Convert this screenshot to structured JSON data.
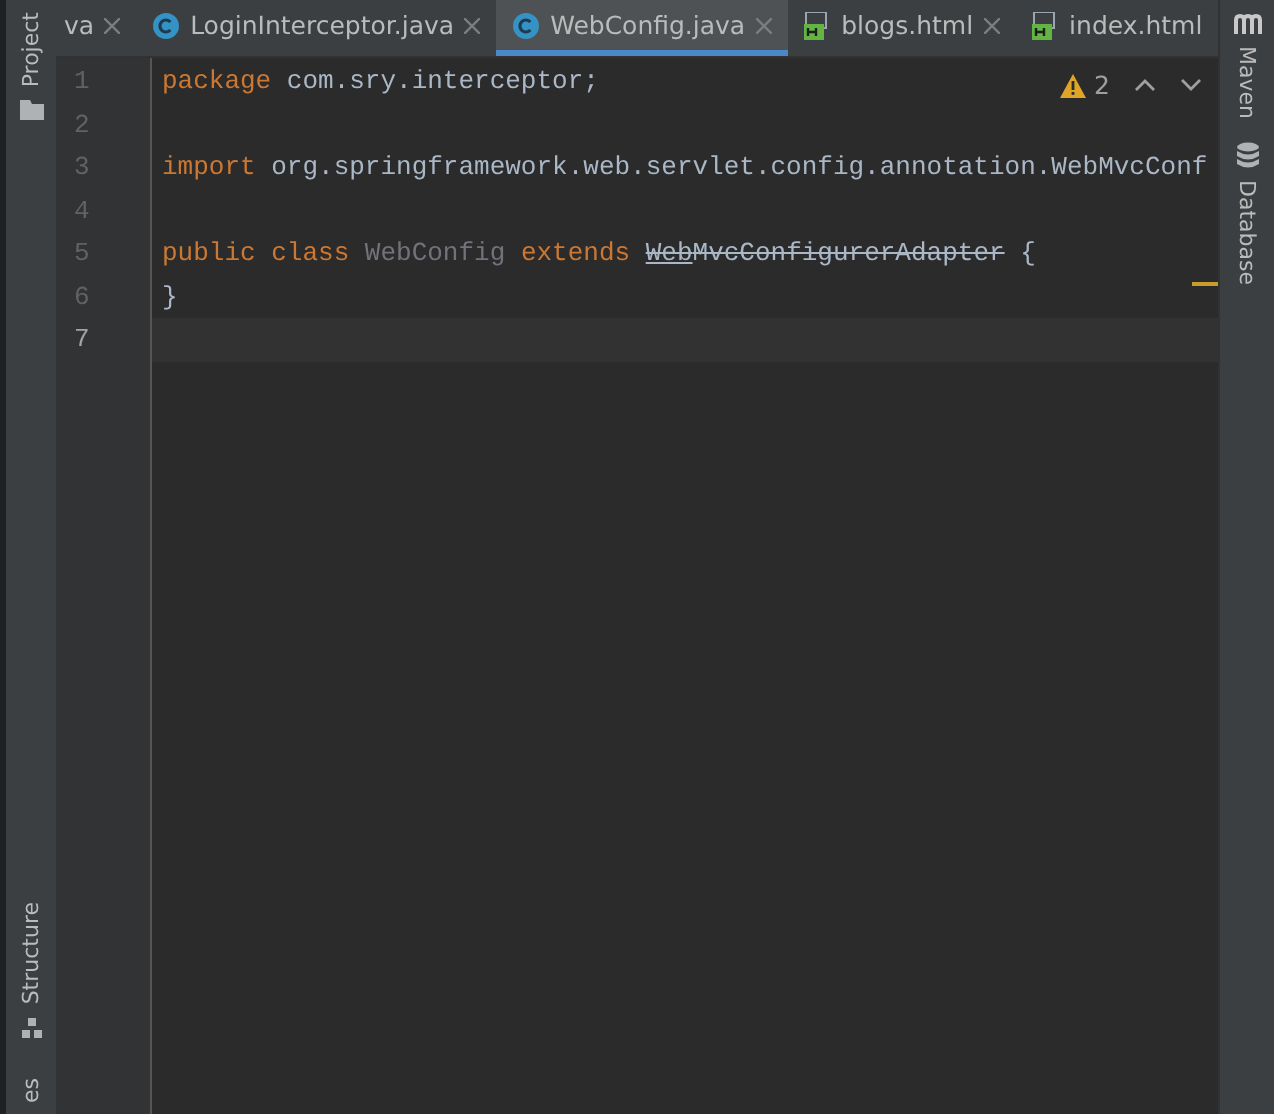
{
  "left_tool_strip": {
    "top": [
      {
        "label": "Project",
        "kind": "folder"
      }
    ],
    "bottom": [
      {
        "label": "Structure",
        "kind": "structure"
      },
      {
        "label": "es",
        "kind": "none"
      }
    ]
  },
  "tabs": [
    {
      "label": "va",
      "kind": "none",
      "closable": true,
      "selected": false
    },
    {
      "label": "LoginInterceptor.java",
      "kind": "java-class",
      "closable": true,
      "selected": false
    },
    {
      "label": "WebConfig.java",
      "kind": "java-class",
      "closable": true,
      "selected": true
    },
    {
      "label": "blogs.html",
      "kind": "html",
      "closable": true,
      "selected": false
    },
    {
      "label": "index.html",
      "kind": "html",
      "closable": false,
      "selected": false
    }
  ],
  "editor": {
    "warnings": {
      "count": "2"
    },
    "lines": [
      {
        "number": "1",
        "current": false,
        "tokens": [
          {
            "kind": "keyword",
            "text": "package"
          },
          {
            "kind": "plain",
            "text": " com.sry.interceptor;"
          }
        ]
      },
      {
        "number": "2",
        "current": false
      },
      {
        "number": "3",
        "current": false,
        "tokens": [
          {
            "kind": "keyword",
            "text": "import"
          },
          {
            "kind": "plain",
            "text": " org.springframework.web.servlet.config.annotation.WebMvcConf"
          }
        ]
      },
      {
        "number": "4",
        "current": false
      },
      {
        "number": "5",
        "current": false,
        "tokens": [
          {
            "kind": "keyword",
            "text": "public class "
          },
          {
            "kind": "unused",
            "text": "WebConfig"
          },
          {
            "kind": "keyword",
            "text": " extends "
          },
          {
            "kind": "deprecated-link",
            "text": "Web"
          },
          {
            "kind": "deprecated",
            "text": "MvcConfigurerAdapter"
          },
          {
            "kind": "plain",
            "text": " {"
          }
        ]
      },
      {
        "number": "6",
        "current": false,
        "tokens": [
          {
            "kind": "plain",
            "text": "}"
          }
        ]
      },
      {
        "number": "7",
        "current": true
      }
    ]
  },
  "right_tool_strip": [
    {
      "label": "Maven",
      "kind": "maven"
    },
    {
      "label": "Database",
      "kind": "database"
    }
  ]
}
